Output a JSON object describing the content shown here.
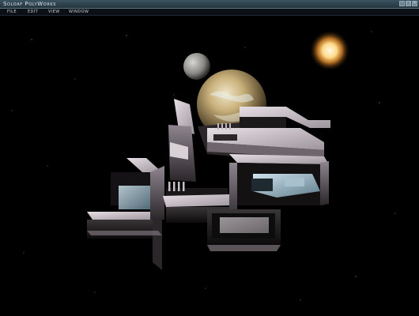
{
  "window": {
    "title": "Soloaf PolyWorks"
  },
  "menu": {
    "items": [
      "File",
      "Edit",
      "View",
      "Window"
    ]
  },
  "window_buttons": [
    "minimize",
    "maximize",
    "close"
  ],
  "colors": {
    "titlebar": "#2f4552",
    "menubar": "#0c1115",
    "viewport": "#000000"
  },
  "scene": {
    "description_icons": [
      "sun",
      "moon",
      "planet",
      "space-station"
    ]
  }
}
